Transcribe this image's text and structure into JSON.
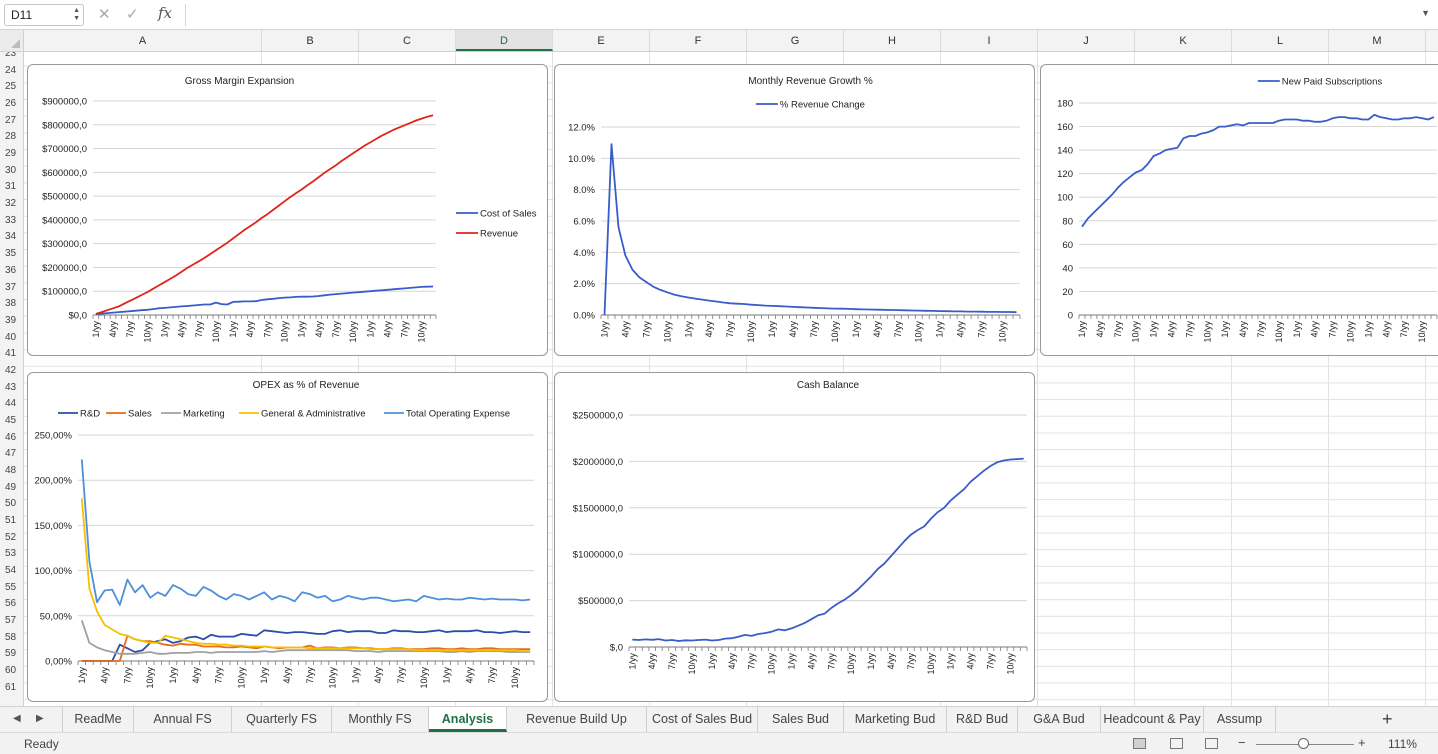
{
  "formula_bar": {
    "cell_ref": "D11",
    "cancel_icon": "close-icon",
    "enter_icon": "check-icon",
    "fx_label": "fx",
    "formula": ""
  },
  "columns": [
    "A",
    "B",
    "C",
    "D",
    "E",
    "F",
    "G",
    "H",
    "I",
    "J",
    "K",
    "L",
    "M"
  ],
  "active_column": "D",
  "rows": [
    "23",
    "24",
    "25",
    "26",
    "27",
    "28",
    "29",
    "30",
    "31",
    "32",
    "33",
    "34",
    "35",
    "36",
    "37",
    "38",
    "39",
    "40",
    "41",
    "42",
    "43",
    "44",
    "45",
    "46",
    "47",
    "48",
    "49",
    "50",
    "51",
    "52",
    "53",
    "54",
    "55",
    "56",
    "57",
    "58",
    "59",
    "60",
    "61"
  ],
  "sheet_tabs": [
    "ReadMe",
    "Annual FS",
    "Quarterly FS",
    "Monthly FS",
    "Analysis",
    "Revenue Build Up",
    "Cost of Sales Bud",
    "Sales Bud",
    "Marketing Bud",
    "R&D Bud",
    "G&A Bud",
    "Headcount & Pay",
    "Assump"
  ],
  "active_tab": "Analysis",
  "status": {
    "ready_text": "Ready",
    "zoom": "111%"
  },
  "x_tick_cycle": [
    "1/yy",
    "4/yy",
    "7/yy",
    "10/yy"
  ],
  "chart_data": [
    {
      "id": "gross-margin",
      "type": "line",
      "title": "Gross Margin Expansion",
      "y_ticks": [
        "$0,0",
        "$100000,0",
        "$200000,0",
        "$300000,0",
        "$400000,0",
        "$500000,0",
        "$600000,0",
        "$700000,0",
        "$800000,0",
        "$900000,0"
      ],
      "ylim": [
        0,
        900000
      ],
      "points": 60,
      "legend_position": "right",
      "grid": true,
      "series": [
        {
          "name": "Cost of Sales",
          "color": "#3a5cc8",
          "values": [
            4000,
            6000,
            8000,
            10000,
            12000,
            14000,
            16000,
            18000,
            20000,
            22000,
            25000,
            28000,
            30000,
            32000,
            34000,
            36000,
            38000,
            40000,
            42000,
            44000,
            44000,
            52000,
            46000,
            44000,
            55000,
            56000,
            57000,
            57000,
            58000,
            63000,
            66000,
            68000,
            71000,
            73000,
            74000,
            76000,
            77000,
            77000,
            78000,
            80000,
            83000,
            86000,
            88000,
            90000,
            92000,
            94000,
            96000,
            98000,
            100000,
            102000,
            104000,
            106000,
            108000,
            110000,
            112000,
            114000,
            116000,
            118000,
            119000,
            120000
          ]
        },
        {
          "name": "Revenue",
          "color": "#e0241b",
          "values": [
            5000,
            12000,
            20000,
            28000,
            36000,
            48000,
            60000,
            72000,
            84000,
            96000,
            110000,
            124000,
            138000,
            152000,
            166000,
            182000,
            198000,
            212000,
            226000,
            240000,
            256000,
            272000,
            288000,
            304000,
            322000,
            340000,
            358000,
            374000,
            390000,
            408000,
            424000,
            442000,
            460000,
            478000,
            496000,
            512000,
            528000,
            546000,
            562000,
            580000,
            598000,
            614000,
            630000,
            648000,
            664000,
            680000,
            696000,
            712000,
            726000,
            740000,
            754000,
            766000,
            778000,
            788000,
            798000,
            808000,
            818000,
            826000,
            834000,
            840000
          ]
        }
      ]
    },
    {
      "id": "monthly-revenue-growth",
      "type": "line",
      "title": "Monthly Revenue Growth %",
      "y_ticks": [
        "0.0%",
        "2.0%",
        "4.0%",
        "6.0%",
        "8.0%",
        "10.0%",
        "12.0%"
      ],
      "ylim": [
        0,
        12
      ],
      "points": 60,
      "legend_position": "top",
      "grid": true,
      "series": [
        {
          "name": "% Revenue Change",
          "color": "#3a5cc8",
          "values": [
            0,
            10.9,
            5.6,
            3.8,
            2.9,
            2.4,
            2.1,
            1.8,
            1.6,
            1.45,
            1.3,
            1.2,
            1.12,
            1.05,
            0.98,
            0.92,
            0.86,
            0.8,
            0.75,
            0.72,
            0.7,
            0.66,
            0.63,
            0.6,
            0.58,
            0.56,
            0.54,
            0.52,
            0.5,
            0.48,
            0.46,
            0.44,
            0.42,
            0.41,
            0.4,
            0.39,
            0.37,
            0.36,
            0.35,
            0.34,
            0.33,
            0.32,
            0.31,
            0.3,
            0.29,
            0.28,
            0.27,
            0.26,
            0.25,
            0.24,
            0.23,
            0.23,
            0.22,
            0.22,
            0.21,
            0.2,
            0.2,
            0.19,
            0.19,
            0.18
          ]
        }
      ]
    },
    {
      "id": "new-paid-subscriptions",
      "type": "line",
      "title": "",
      "y_ticks": [
        "0",
        "20",
        "40",
        "60",
        "80",
        "100",
        "120",
        "140",
        "160",
        "180"
      ],
      "ylim": [
        0,
        180
      ],
      "points": 60,
      "legend_position": "top",
      "grid": true,
      "series": [
        {
          "name": "New Paid Subscriptions",
          "color": "#3a5cc8",
          "values": [
            75,
            82,
            87,
            92,
            97,
            102,
            108,
            113,
            117,
            121,
            123,
            128,
            135,
            137,
            140,
            141,
            142,
            150,
            152,
            152,
            154,
            155,
            157,
            160,
            160,
            161,
            162,
            161,
            163,
            163,
            163,
            163,
            163,
            165,
            166,
            166,
            166,
            165,
            165,
            164,
            164,
            165,
            167,
            168,
            168,
            167,
            167,
            166,
            166,
            170,
            168,
            167,
            166,
            166,
            167,
            167,
            168,
            167,
            166,
            168
          ]
        }
      ]
    },
    {
      "id": "opex-percent-revenue",
      "type": "line",
      "title": "OPEX as % of Revenue",
      "y_ticks": [
        "0,00%",
        "50,00%",
        "100,00%",
        "150,00%",
        "200,00%",
        "250,00%"
      ],
      "ylim": [
        0,
        250
      ],
      "points": 60,
      "legend_position": "top",
      "grid": true,
      "series": [
        {
          "name": "R&D",
          "color": "#2a4ea8",
          "values": [
            0,
            0,
            0,
            0,
            0,
            18,
            14,
            10,
            12,
            20,
            22,
            24,
            20,
            22,
            26,
            27,
            24,
            29,
            27,
            27,
            27,
            30,
            29,
            28,
            34,
            33,
            32,
            31,
            32,
            32,
            31,
            30,
            30,
            33,
            34,
            32,
            33,
            33,
            33,
            31,
            31,
            34,
            33,
            33,
            32,
            32,
            33,
            34,
            32,
            33,
            33,
            33,
            34,
            32,
            32,
            31,
            32,
            33,
            32,
            32
          ]
        },
        {
          "name": "Sales",
          "color": "#e46c1a",
          "values": [
            0,
            0,
            0,
            0,
            0,
            0,
            28,
            24,
            22,
            22,
            20,
            18,
            17,
            19,
            18,
            18,
            16,
            16,
            16,
            15,
            15,
            16,
            15,
            14,
            16,
            15,
            14,
            15,
            15,
            15,
            17,
            14,
            15,
            15,
            14,
            15,
            15,
            14,
            14,
            13,
            13,
            14,
            14,
            13,
            13,
            13,
            14,
            14,
            13,
            13,
            14,
            13,
            13,
            14,
            14,
            13,
            13,
            13,
            13,
            13
          ]
        },
        {
          "name": "Marketing",
          "color": "#a0a0a0",
          "values": [
            45,
            20,
            15,
            12,
            10,
            8,
            8,
            8,
            9,
            10,
            8,
            8,
            9,
            9,
            9,
            10,
            10,
            9,
            10,
            10,
            10,
            10,
            10,
            10,
            11,
            10,
            11,
            12,
            12,
            12,
            12,
            12,
            12,
            12,
            12,
            12,
            11,
            11,
            11,
            10,
            11,
            11,
            11,
            11,
            11,
            11,
            11,
            11,
            10,
            10,
            11,
            10,
            11,
            11,
            11,
            11,
            10,
            10,
            10,
            10
          ]
        },
        {
          "name": "General & Administrative",
          "color": "#f6c000",
          "values": [
            180,
            80,
            55,
            40,
            35,
            30,
            28,
            24,
            22,
            20,
            20,
            28,
            26,
            24,
            22,
            20,
            19,
            19,
            18,
            18,
            17,
            17,
            16,
            16,
            16,
            15,
            15,
            15,
            15,
            15,
            14,
            14,
            14,
            14,
            14,
            14,
            14,
            14,
            13,
            13,
            13,
            13,
            13,
            13,
            12,
            12,
            12,
            12,
            12,
            12,
            12,
            12,
            12,
            12,
            12,
            12,
            12,
            12,
            11,
            11
          ]
        },
        {
          "name": "Total Operating Expense",
          "color": "#4f8fd8",
          "values": [
            223,
            110,
            65,
            78,
            79,
            62,
            90,
            76,
            84,
            70,
            76,
            72,
            84,
            80,
            74,
            72,
            82,
            78,
            72,
            68,
            74,
            72,
            68,
            72,
            76,
            68,
            72,
            70,
            66,
            76,
            74,
            70,
            72,
            66,
            68,
            72,
            70,
            68,
            70,
            70,
            68,
            66,
            67,
            68,
            66,
            72,
            70,
            68,
            69,
            68,
            68,
            70,
            69,
            68,
            69,
            68,
            68,
            68,
            67,
            68
          ]
        }
      ]
    },
    {
      "id": "cash-balance",
      "type": "line",
      "title": "Cash Balance",
      "y_ticks": [
        "$,0",
        "$500000,0",
        "$1000000,0",
        "$1500000,0",
        "$2000000,0",
        "$2500000,0"
      ],
      "ylim": [
        0,
        2500000
      ],
      "points": 60,
      "legend_position": "none",
      "grid": true,
      "series": [
        {
          "name": "",
          "color": "#3a5cc8",
          "values": [
            80000,
            75000,
            82000,
            78000,
            85000,
            70000,
            75000,
            65000,
            72000,
            70000,
            75000,
            80000,
            70000,
            75000,
            90000,
            95000,
            110000,
            130000,
            120000,
            140000,
            150000,
            165000,
            190000,
            180000,
            200000,
            230000,
            260000,
            300000,
            340000,
            360000,
            420000,
            470000,
            510000,
            560000,
            620000,
            690000,
            760000,
            840000,
            900000,
            980000,
            1060000,
            1140000,
            1210000,
            1260000,
            1300000,
            1380000,
            1450000,
            1500000,
            1580000,
            1640000,
            1700000,
            1780000,
            1840000,
            1900000,
            1950000,
            1990000,
            2010000,
            2020000,
            2025000,
            2030000
          ]
        }
      ]
    }
  ]
}
